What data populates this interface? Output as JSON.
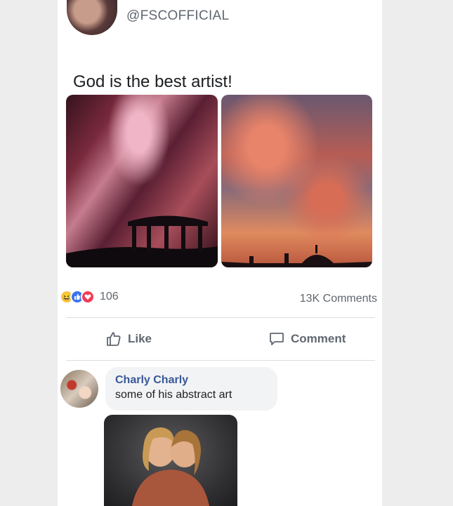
{
  "post": {
    "handle": "@FSCOFFICIAL",
    "text": "God is the best artist!",
    "reaction_count": "106",
    "comments_count": "13K Comments",
    "reactions": [
      "haha",
      "like",
      "love"
    ]
  },
  "actions": {
    "like_label": "Like",
    "comment_label": "Comment"
  },
  "comment": {
    "author": "Charly Charly",
    "text": "some of his abstract art"
  },
  "colors": {
    "link_blue": "#385898",
    "meta_gray": "#606770",
    "like_blue": "#3b74f0",
    "love_red": "#ef3b55",
    "haha_yellow": "#f7c548"
  }
}
